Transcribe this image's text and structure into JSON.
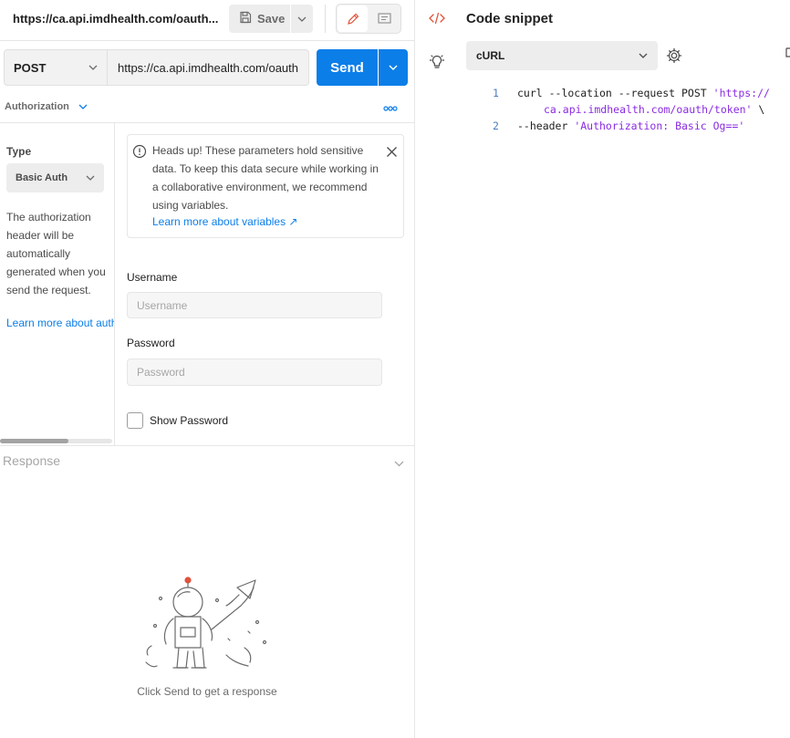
{
  "header": {
    "tab_title": "https://ca.api.imdhealth.com/oauth...",
    "save_label": "Save"
  },
  "request": {
    "method": "POST",
    "url": "https://ca.api.imdhealth.com/oauth",
    "send_label": "Send"
  },
  "tabs": {
    "active": "Authorization"
  },
  "auth": {
    "type_label": "Type",
    "type_value": "Basic Auth",
    "description": "The authorization header will be automatically generated when you send the request.",
    "learn_more_left": "Learn more about authorization",
    "alert_text": "Heads up! These parameters hold sensitive data. To keep this data secure while working in a collaborative environment, we recommend using variables.",
    "alert_link": "Learn more about variables ↗",
    "username_label": "Username",
    "username_placeholder": "Username",
    "password_label": "Password",
    "password_placeholder": "Password",
    "show_password_label": "Show Password"
  },
  "response": {
    "label": "Response",
    "empty_caption": "Click Send to get a response"
  },
  "code_snippet": {
    "title": "Code snippet",
    "language": "cURL",
    "lines": [
      {
        "num": "1",
        "plain": "curl --location --request POST ",
        "string": "'https://",
        "cont": "ca.api.imdhealth.com/oauth/token'",
        "tail": " \\"
      },
      {
        "num": "2",
        "plain": "--header ",
        "string": "'Authorization: Basic Og=='",
        "tail": ""
      }
    ]
  },
  "colors": {
    "accent": "#0c7ee8",
    "code_icon": "#e0533c",
    "edit_icon": "#e0533c",
    "code_string": "#8a2be2",
    "line_number": "#4c7fc0"
  }
}
